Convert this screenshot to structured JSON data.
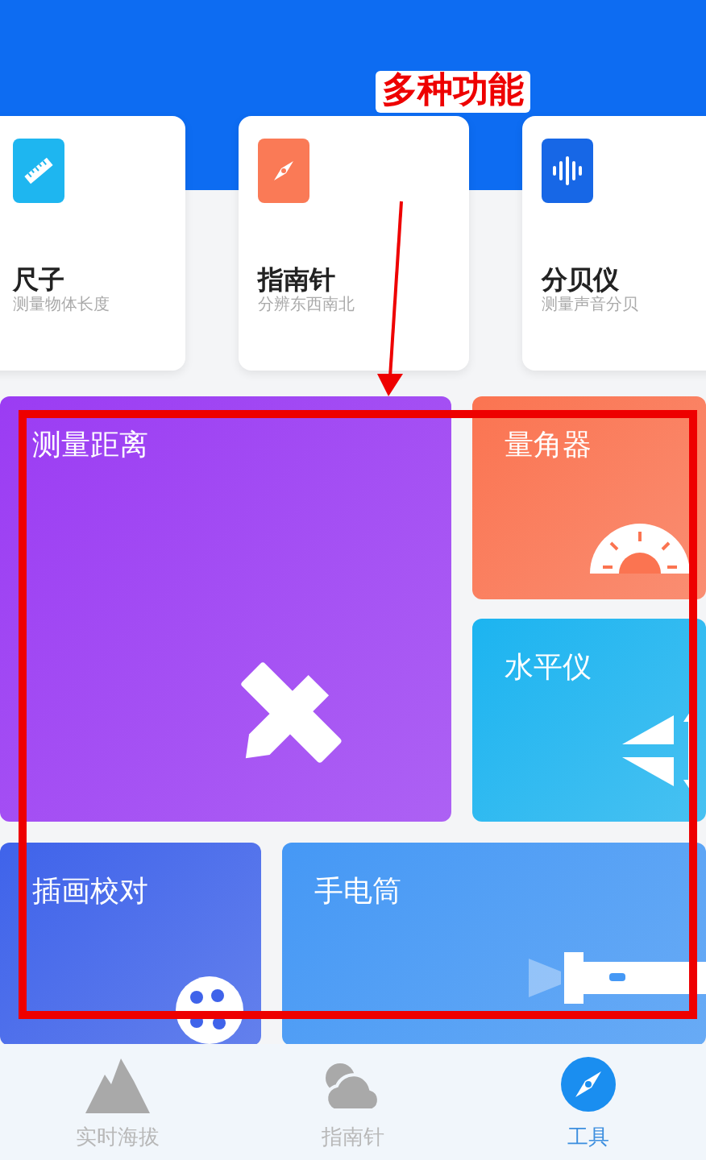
{
  "tool_cards": [
    {
      "kind": "ruler",
      "title": "尺子",
      "subtitle": "测量物体长度",
      "color": "#1eb6f0"
    },
    {
      "kind": "compass",
      "title": "指南针",
      "subtitle": "分辨东西南北",
      "color": "#fa7a56"
    },
    {
      "kind": "sound",
      "title": "分贝仪",
      "subtitle": "测量声音分贝",
      "color": "#1767e6"
    }
  ],
  "tiles": [
    {
      "kind": "distance",
      "title": "测量距离",
      "color": "#9b3cf3"
    },
    {
      "kind": "protractor",
      "title": "量角器",
      "color": "#fb7451"
    },
    {
      "kind": "level",
      "title": "水平仪",
      "color": "#1cb4f0"
    },
    {
      "kind": "palette",
      "title": "插画校对",
      "color": "#3f63ea"
    },
    {
      "kind": "flashlight",
      "title": "手电筒",
      "color": "#4598f5"
    }
  ],
  "bottom_nav": [
    {
      "kind": "mountain",
      "label": "实时海拔",
      "selected": false
    },
    {
      "kind": "cloud",
      "label": "指南针",
      "selected": false
    },
    {
      "kind": "compass",
      "label": "工具",
      "selected": true
    }
  ],
  "annotation": {
    "text": "多种功能"
  }
}
